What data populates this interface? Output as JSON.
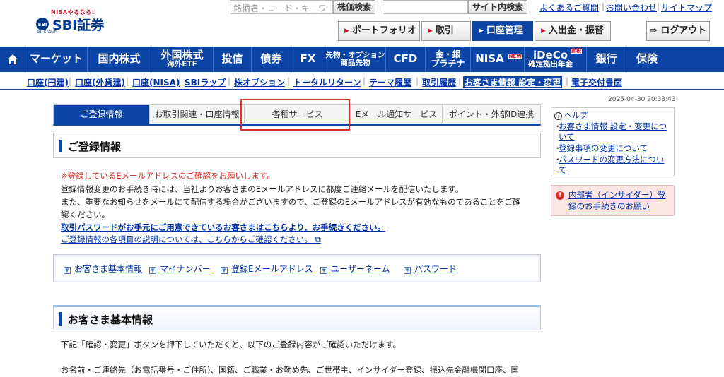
{
  "logo": {
    "tagline": "NISAやるなら!",
    "name": "SBI証券",
    "group": "SBI GROUP"
  },
  "search": {
    "placeholder": "銘柄名・コード・キーワ",
    "stock_search_label": "株価検索",
    "site_search_label": "サイト内検索"
  },
  "toplinks": [
    "よくあるご質問",
    "お問い合わせ",
    "サイトマップ"
  ],
  "header_buttons": [
    {
      "label": "ポートフォリオ",
      "active": false
    },
    {
      "label": "取引",
      "active": false
    },
    {
      "label": "口座管理",
      "active": true
    },
    {
      "label": "入出金・振替",
      "active": false
    }
  ],
  "logout_label": "ログアウト",
  "main_nav": [
    {
      "line1": "マーケット",
      "line2": ""
    },
    {
      "line1": "国内株式",
      "line2": ""
    },
    {
      "line1": "外国株式",
      "line2": "海外ETF"
    },
    {
      "line1": "投信",
      "line2": ""
    },
    {
      "line1": "債券",
      "line2": ""
    },
    {
      "line1": "FX",
      "line2": ""
    },
    {
      "line1": "先物・オプション",
      "line2": "商品先物"
    },
    {
      "line1": "CFD",
      "line2": ""
    },
    {
      "line1": "金・銀",
      "line2": "プラチナ"
    },
    {
      "line1": "NISA",
      "line2": ""
    },
    {
      "line1": "iDeCo",
      "line2": "確定拠出年金"
    },
    {
      "line1": "銀行",
      "line2": ""
    },
    {
      "line1": "保険",
      "line2": ""
    }
  ],
  "nav_badges": {
    "nisa": "NEW",
    "ideco": "節税"
  },
  "sub_nav": [
    "口座(円建)",
    "口座(外貨建)",
    "口座(NISA)",
    "SBIラップ",
    "株オプション",
    "トータルリターン",
    "テーマ履歴",
    "取引履歴",
    "お客さま情報 設定・変更",
    "電子交付書面"
  ],
  "sub_nav_active": "お客さま情報 設定・変更",
  "timestamp": "2025-04-30 20:33:43",
  "tabs": [
    "ご登録情報",
    "お取引関連・口座情報",
    "各種サービス",
    "Eメール通知サービス",
    "ポイント・外部ID連携"
  ],
  "active_tab": "ご登録情報",
  "section1_title": "ご登録情報",
  "notice": {
    "red": "※登録しているEメールアドレスのご確認をお願いします。",
    "line1": "登録情報変更のお手続き時には、当社よりお客さまのEメールアドレスに都度ご連絡メールを配信いたします。",
    "line2": "また、重要なお知らせをメールにて配信する場合がございますので、ご登録のEメールアドレスが有効なものであることをご確",
    "line3": "認ください。",
    "link_bold": "取引パスワードがお手元にご用意できているお客さまはこちらより、お手続きください。",
    "link_help": "ご登録情報の各項目の説明については、こちらからご確認ください。"
  },
  "anchors": [
    "お客さま基本情報",
    "マイナンバー",
    "登録Eメールアドレス",
    "ユーザーネーム",
    "パスワード"
  ],
  "section2_title": "お客さま基本情報",
  "section2_text1": "下記「確認・変更」ボタンを押下していただくと、以下のご登録内容がご確認いただけます。",
  "section2_text2": "お名前・ご連絡先（お電話番号・ご住所)、国籍、ご職業・お勤め先、ご世帯主、インサイダー登録、振込先金融機関口座、国",
  "help": {
    "title": "ヘルプ",
    "items": [
      "お客さま情報 設定・変更について",
      "登録事項の変更について",
      "パスワードの変更方法について"
    ]
  },
  "insider": "内部者（インサイダー）登録のお手続きのお願い",
  "colors": {
    "brand_blue": "#0c45a5",
    "alert_red": "#d7322b"
  }
}
